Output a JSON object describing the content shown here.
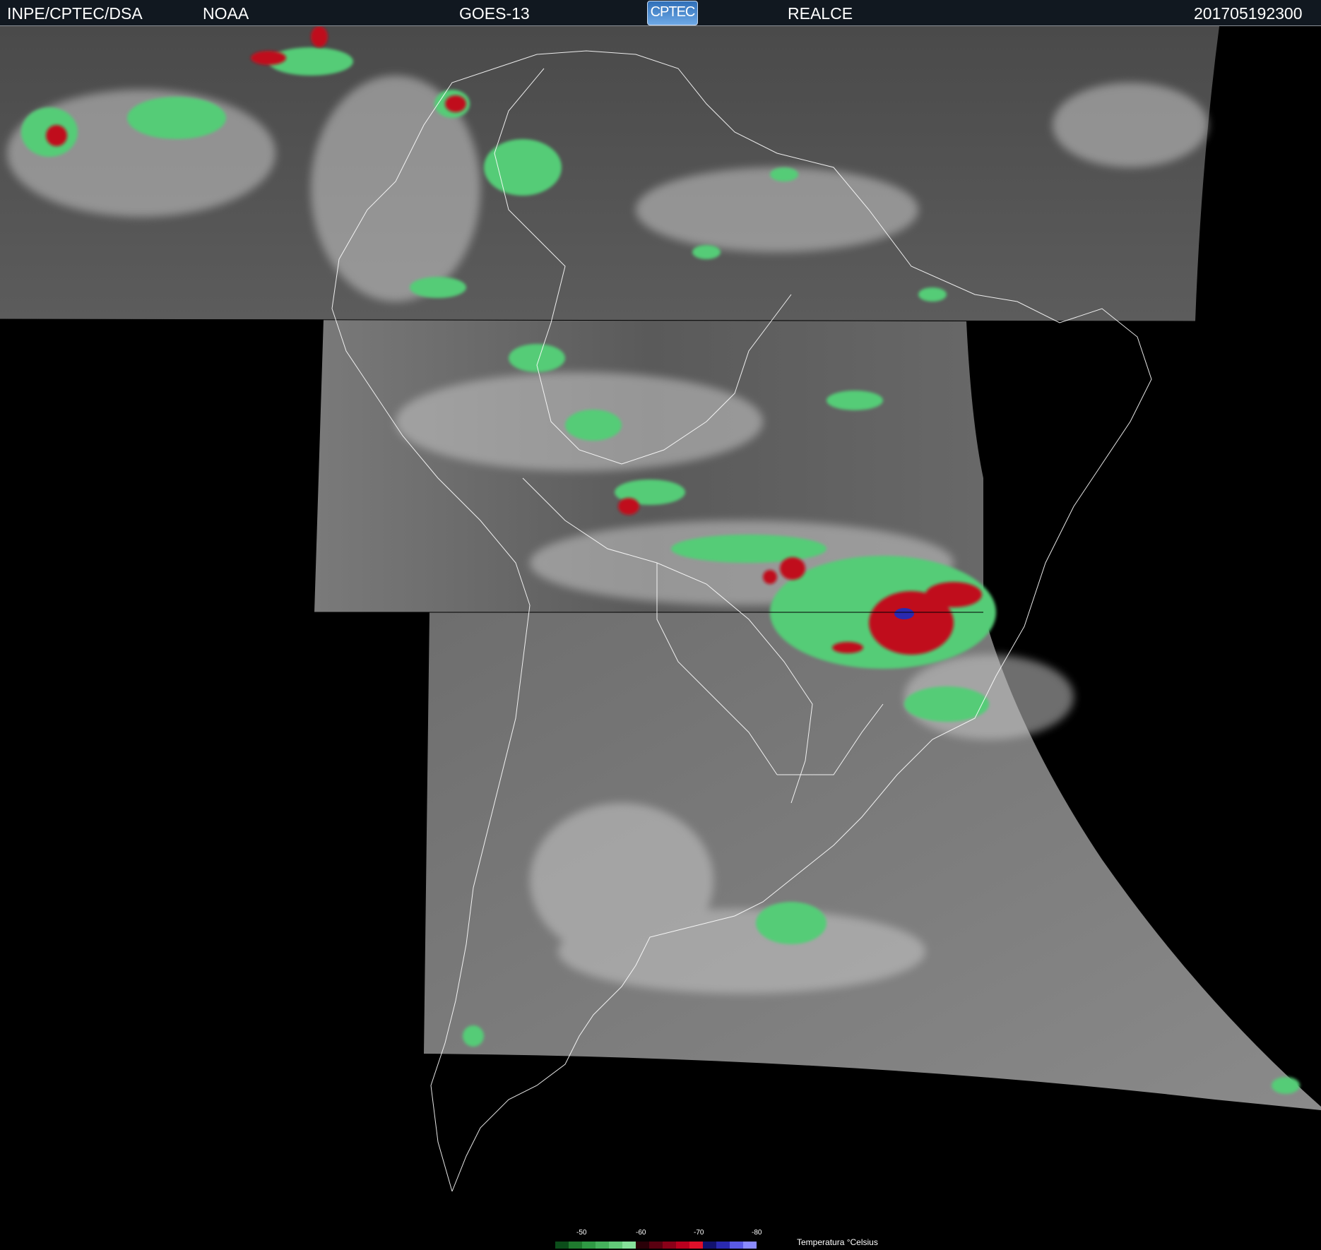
{
  "header": {
    "agency": "INPE/CPTEC/DSA",
    "source": "NOAA",
    "satellite": "GOES-13",
    "logo_text": "CPTEC",
    "product": "REALCE",
    "timestamp": "201705192300"
  },
  "legend": {
    "title": "Temperatura °Celsius",
    "ticks": [
      "-50",
      "-60",
      "-70",
      "-80"
    ],
    "colors": [
      "#0b4d1a",
      "#1f7a2e",
      "#2f9a44",
      "#45b25c",
      "#62c978",
      "#86e09a",
      "#2a0008",
      "#5a0010",
      "#8a0018",
      "#b8001e",
      "#e0102a",
      "#12126e",
      "#2a2ab0",
      "#5a5ae6",
      "#8a8aff"
    ]
  },
  "colors": {
    "background": "#000000",
    "header_bg": "#111820",
    "cloud_green": "#55cc77",
    "cloud_red": "#c0101e",
    "cloud_blue": "#2a2ab0",
    "coastline": "#ffffff"
  }
}
